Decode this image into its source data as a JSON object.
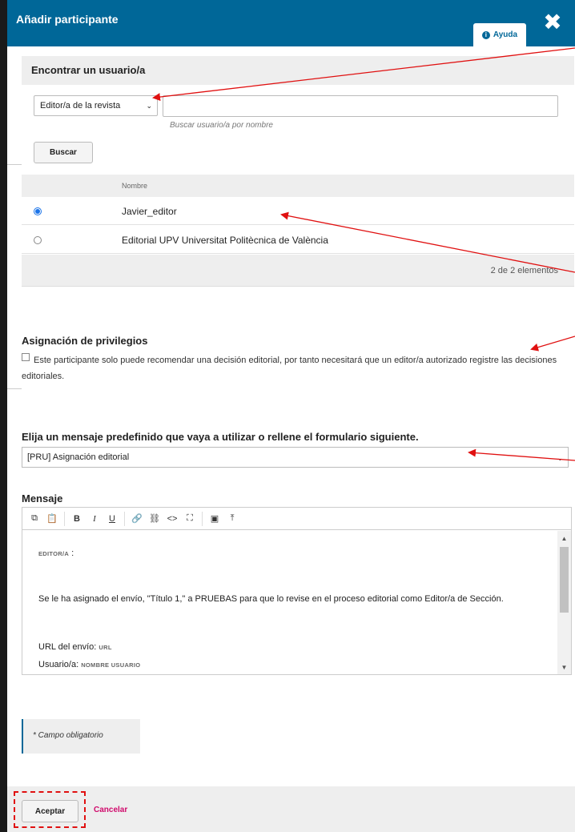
{
  "modal": {
    "title": "Añadir participante",
    "help_label": "Ayuda",
    "close_symbol": "✖"
  },
  "find_user": {
    "title": "Encontrar un usuario/a",
    "role_selected": "Editor/a de la revista",
    "search_value": "",
    "search_help": "Buscar usuario/a por nombre",
    "search_button": "Buscar"
  },
  "results": {
    "column_name": "Nombre",
    "rows": [
      {
        "name": "Javier_editor",
        "selected": true
      },
      {
        "name": "Editorial UPV Universitat Politècnica de València",
        "selected": false
      }
    ],
    "count_text": "2 de 2 elementos"
  },
  "privileges": {
    "title": "Asignación de privilegios",
    "checkbox_label": "Este participante solo puede recomendar una decisión editorial, por tanto necesitará que un editor/a autorizado registre las decisiones editoriales.",
    "checked": false
  },
  "template": {
    "title": "Elija un mensaje predefinido que vaya a utilizar o rellene el formulario siguiente.",
    "selected": "[PRU] Asignación editorial"
  },
  "message": {
    "label": "Mensaje",
    "toolbar": [
      "copy-icon",
      "paste-icon",
      "bold-icon",
      "italic-icon",
      "underline-icon",
      "link-icon",
      "unlink-icon",
      "code-icon",
      "fullscreen-icon",
      "image-icon",
      "upload-icon"
    ],
    "greeting_tag": "EDITOR/A",
    "greeting_suffix": ":",
    "body_line": "Se le ha asignado el envío, \"Título 1,\" a PRUEBAS para que lo revise en el proceso editorial como Editor/a de Sección.",
    "url_label": "URL del envío:",
    "url_tag": "URL",
    "user_label": "Usuario/a:",
    "user_tag": "NOMBRE USUARIO"
  },
  "required_note": "* Campo obligatorio",
  "footer": {
    "accept": "Aceptar",
    "cancel": "Cancelar"
  },
  "colors": {
    "header": "#006798",
    "cancel": "#d00a6c",
    "annotation": "#e01010"
  }
}
